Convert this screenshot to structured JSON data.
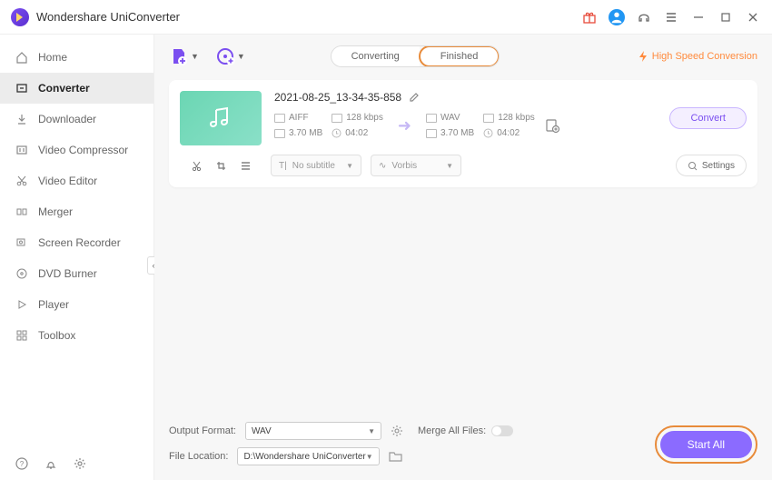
{
  "app_title": "Wondershare UniConverter",
  "sidebar": {
    "items": [
      {
        "label": "Home"
      },
      {
        "label": "Converter"
      },
      {
        "label": "Downloader"
      },
      {
        "label": "Video Compressor"
      },
      {
        "label": "Video Editor"
      },
      {
        "label": "Merger"
      },
      {
        "label": "Screen Recorder"
      },
      {
        "label": "DVD Burner"
      },
      {
        "label": "Player"
      },
      {
        "label": "Toolbox"
      }
    ],
    "active_index": 1
  },
  "tabs": {
    "converting": "Converting",
    "finished": "Finished"
  },
  "high_speed": "High Speed Conversion",
  "file": {
    "name": "2021-08-25_13-34-35-858",
    "src": {
      "format": "AIFF",
      "bitrate": "128 kbps",
      "size": "3.70 MB",
      "duration": "04:02"
    },
    "dst": {
      "format": "WAV",
      "bitrate": "128 kbps",
      "size": "3.70 MB",
      "duration": "04:02"
    },
    "subtitle": "No subtitle",
    "audio_codec": "Vorbis",
    "settings_label": "Settings",
    "convert_label": "Convert"
  },
  "footer": {
    "output_format_label": "Output Format:",
    "output_format_value": "WAV",
    "file_location_label": "File Location:",
    "file_location_value": "D:\\Wondershare UniConverter",
    "merge_label": "Merge All Files:",
    "start_all": "Start All"
  }
}
